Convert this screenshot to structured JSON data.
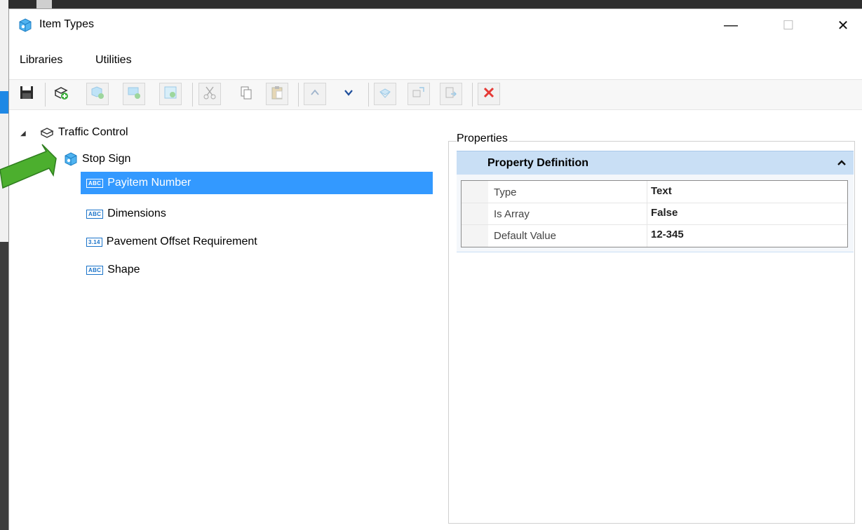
{
  "window": {
    "title": "Item Types"
  },
  "window_controls": {
    "minimize": "—",
    "maximize": "☐",
    "close": "✕"
  },
  "menu": {
    "items": [
      "Libraries",
      "Utilities"
    ]
  },
  "toolbar": {
    "buttons": [
      "save-icon",
      "add-library-icon",
      "add-item-icon",
      "add-sub-item-icon",
      "add-property-icon",
      "cut-icon",
      "copy-icon",
      "paste-icon",
      "move-up-icon",
      "move-down-icon",
      "import-icon",
      "rename-icon",
      "export-icon",
      "delete-icon"
    ]
  },
  "tree": {
    "root": "Traffic Control",
    "item": "Stop Sign",
    "properties": [
      {
        "label": "Payitem Number",
        "badge": "ABC",
        "selected": true
      },
      {
        "label": "Dimensions",
        "badge": "ABC",
        "selected": false
      },
      {
        "label": "Pavement Offset Requirement",
        "badge": "3.14",
        "selected": false
      },
      {
        "label": "Shape",
        "badge": "ABC",
        "selected": false
      }
    ]
  },
  "properties_panel": {
    "label": "Properties",
    "section": "Property Definition",
    "rows": [
      {
        "name": "Type",
        "value": "Text"
      },
      {
        "name": "Is Array",
        "value": "False"
      },
      {
        "name": "Default Value",
        "value": "12-345"
      }
    ]
  },
  "colors": {
    "selection": "#3399ff",
    "section_header": "#c9dff5",
    "arrow": "#4caf2e",
    "delete": "#e53935"
  }
}
